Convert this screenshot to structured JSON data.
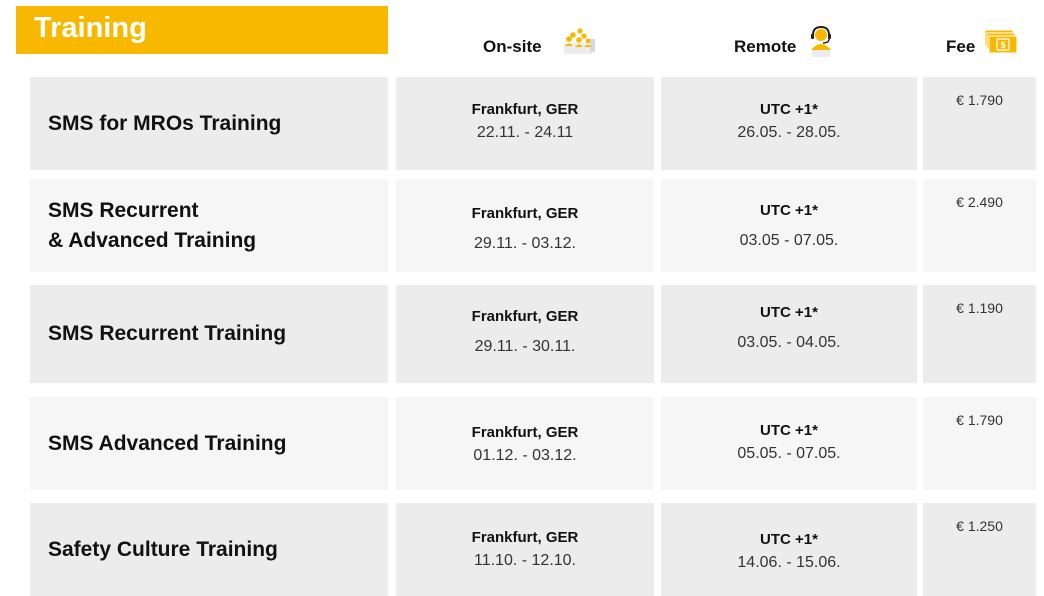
{
  "title": "Training",
  "columns": {
    "onsite": "On-site",
    "remote": "Remote",
    "fee": "Fee"
  },
  "icons": {
    "onsite": "group-of-people-icon",
    "remote": "headset-operator-icon",
    "fee": "money-bills-icon"
  },
  "colors": {
    "accent": "#f8b800",
    "row_dark": "#ececec",
    "row_light": "#f6f6f6"
  },
  "rows": [
    {
      "name": "SMS for MROs Training",
      "onsite_location": "Frankfurt, GER",
      "onsite_dates": "22.11. - 24.11",
      "remote_zone": "UTC +1*",
      "remote_dates": "26.05. - 28.05.",
      "fee": "€ 1.790"
    },
    {
      "name": "SMS Recurrent\n& Advanced Training",
      "onsite_location": "Frankfurt, GER",
      "onsite_dates": "29.11. - 03.12.",
      "remote_zone": "UTC +1*",
      "remote_dates": "03.05 - 07.05.",
      "fee": "€ 2.490"
    },
    {
      "name": "SMS Recurrent Training",
      "onsite_location": "Frankfurt, GER",
      "onsite_dates": "29.11. - 30.11.",
      "remote_zone": "UTC +1*",
      "remote_dates": "03.05. - 04.05.",
      "fee": "€ 1.190"
    },
    {
      "name": "SMS Advanced Training",
      "onsite_location": "Frankfurt, GER",
      "onsite_dates": "01.12. - 03.12.",
      "remote_zone": "UTC +1*",
      "remote_dates": "05.05. - 07.05.",
      "fee": "€ 1.790"
    },
    {
      "name": "Safety Culture Training",
      "onsite_location": "Frankfurt, GER",
      "onsite_dates": "11.10. - 12.10.",
      "remote_zone": "UTC +1*",
      "remote_dates": "14.06. - 15.06.",
      "fee": "€ 1.250"
    }
  ]
}
